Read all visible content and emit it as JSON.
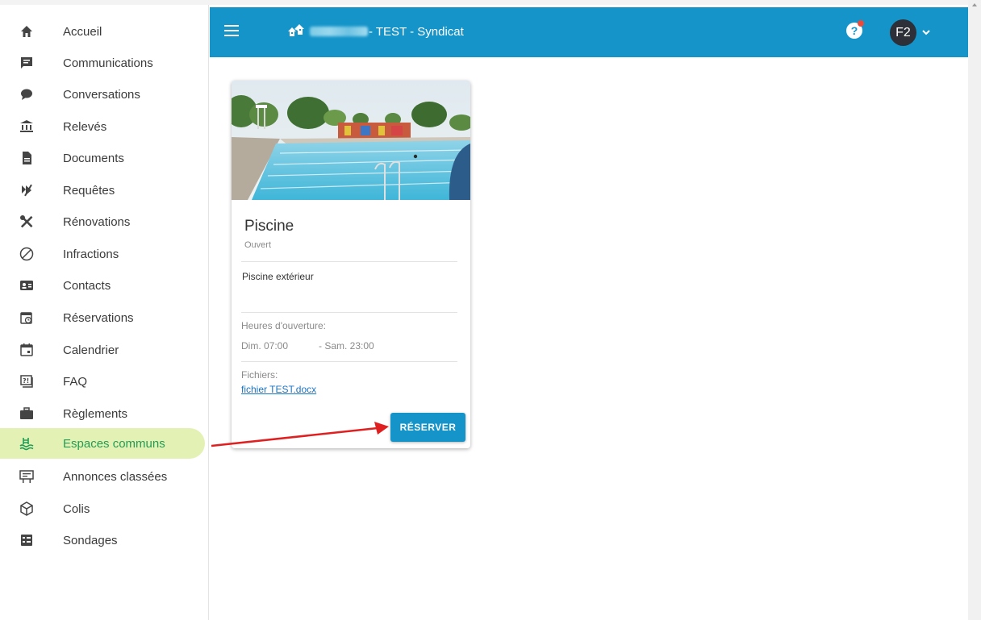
{
  "sidebar": {
    "items": [
      {
        "label": "Accueil",
        "icon": "home-icon"
      },
      {
        "label": "Communications",
        "icon": "message-icon"
      },
      {
        "label": "Conversations",
        "icon": "chat-bubble-icon"
      },
      {
        "label": "Relevés",
        "icon": "bank-icon"
      },
      {
        "label": "Documents",
        "icon": "document-icon"
      },
      {
        "label": "Requêtes",
        "icon": "request-icon"
      },
      {
        "label": "Rénovations",
        "icon": "tools-icon"
      },
      {
        "label": "Infractions",
        "icon": "block-icon"
      },
      {
        "label": "Contacts",
        "icon": "contact-card-icon"
      },
      {
        "label": "Réservations",
        "icon": "calendar-clock-icon"
      },
      {
        "label": "Calendrier",
        "icon": "calendar-icon"
      },
      {
        "label": "FAQ",
        "icon": "faq-icon"
      },
      {
        "label": "Règlements",
        "icon": "briefcase-icon"
      },
      {
        "label": "Espaces communs",
        "icon": "pool-icon",
        "active": true
      },
      {
        "label": "Annonces classées",
        "icon": "billboard-icon"
      },
      {
        "label": "Colis",
        "icon": "package-icon"
      },
      {
        "label": "Sondages",
        "icon": "poll-icon"
      }
    ]
  },
  "header": {
    "title": "- TEST - Syndicat",
    "help_label": "?",
    "avatar_label": "F2"
  },
  "card": {
    "title": "Piscine",
    "status": "Ouvert",
    "description": "Piscine extérieur",
    "hours_label": "Heures d'ouverture:",
    "hours_start": "Dim. 07:00",
    "hours_end": "- Sam. 23:00",
    "files_label": "Fichiers:",
    "file_name": "fichier TEST.docx",
    "reserve_label": "RÉSERVER"
  },
  "colors": {
    "header": "#1594c9",
    "active_nav_bg": "#e3f2b4",
    "active_nav_text": "#1f9d55",
    "annotation_arrow": "#e02020"
  }
}
